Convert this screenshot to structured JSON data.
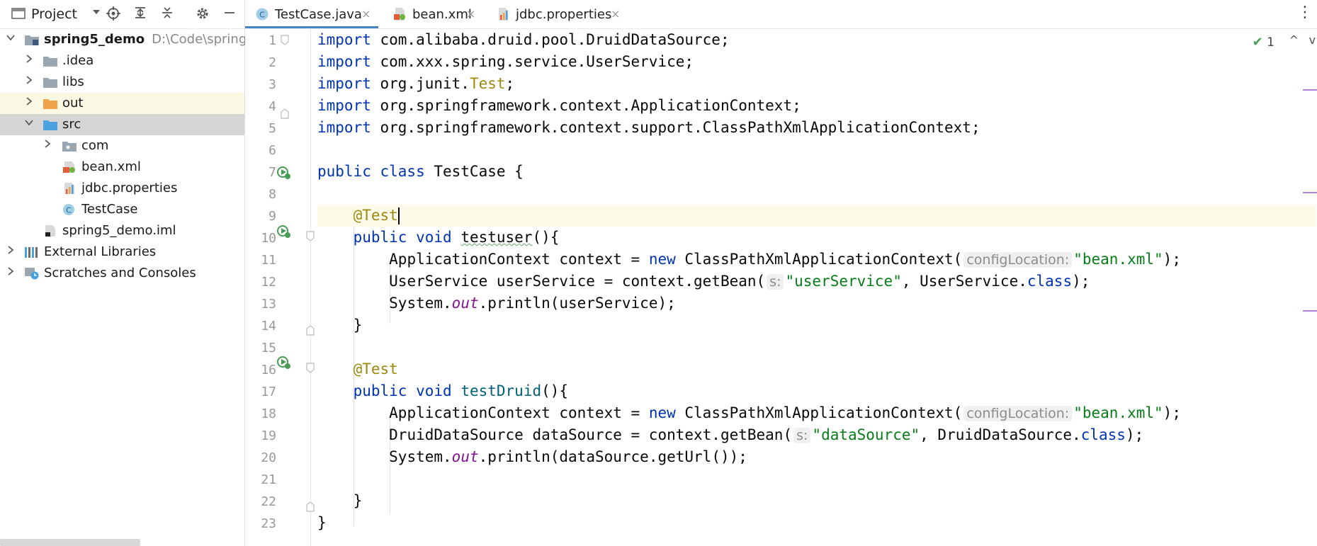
{
  "project": {
    "title": "Project",
    "icons": [
      "project-view-icon",
      "dropdown-chevron-icon",
      "locate-target-icon",
      "expand-all-icon",
      "collapse-all-icon",
      "gear-icon",
      "minimize-icon"
    ]
  },
  "tree": [
    {
      "label": "spring5_demo",
      "path": "D:\\Code\\spring\\s",
      "icon": "module-folder-icon",
      "expanded": true
    },
    {
      "label": ".idea",
      "icon": "folder-icon"
    },
    {
      "label": "libs",
      "icon": "folder-icon"
    },
    {
      "label": "out",
      "icon": "orange-folder-icon"
    },
    {
      "label": "src",
      "icon": "source-folder-icon",
      "expanded": true
    },
    {
      "label": "com",
      "icon": "package-icon"
    },
    {
      "label": "bean.xml",
      "icon": "xml-file-icon"
    },
    {
      "label": "jdbc.properties",
      "icon": "properties-file-icon"
    },
    {
      "label": "TestCase",
      "icon": "java-class-icon"
    },
    {
      "label": "spring5_demo.iml",
      "icon": "iml-file-icon"
    },
    {
      "label": "External Libraries",
      "icon": "libraries-icon"
    },
    {
      "label": "Scratches and Consoles",
      "icon": "scratches-icon"
    }
  ],
  "tabs": [
    {
      "label": "TestCase.java",
      "icon": "java-class-icon",
      "active": true
    },
    {
      "label": "bean.xml",
      "icon": "xml-file-icon",
      "active": false
    },
    {
      "label": "jdbc.properties",
      "icon": "properties-file-icon",
      "active": false
    }
  ],
  "tab_close": "×",
  "tab_more": "⋮",
  "inspection": {
    "count": "1",
    "up": "^",
    "down": "v"
  },
  "code": {
    "line_numbers": [
      "1",
      "2",
      "3",
      "4",
      "5",
      "6",
      "7",
      "8",
      "9",
      "10",
      "11",
      "12",
      "13",
      "14",
      "15",
      "16",
      "17",
      "18",
      "19",
      "20",
      "21",
      "22",
      "23"
    ],
    "l1": {
      "kw": "import",
      "text": " com.alibaba.druid.pool.DruidDataSource;"
    },
    "l2": {
      "kw": "import",
      "text": " com.xxx.spring.service.UserService;"
    },
    "l3": {
      "kw": "import",
      "pre": " org.junit.",
      "ann": "Test",
      "post": ";"
    },
    "l4": {
      "kw": "import",
      "text": " org.springframework.context.ApplicationContext;"
    },
    "l5": {
      "kw": "import",
      "text": " org.springframework.context.support.ClassPathXmlApplicationContext;"
    },
    "l7": {
      "kw": "public class",
      "text": " TestCase {"
    },
    "l9": {
      "ann": "@Test"
    },
    "l10": {
      "kw": "public void",
      "name": "testuser",
      "text": "(){"
    },
    "l11": {
      "pre": "ApplicationContext context = ",
      "kw": "new",
      "mid": " ClassPathXmlApplicationContext(",
      "hint": "configLocation:",
      "str": "\"bean.xml\"",
      "post": ");"
    },
    "l12": {
      "pre": "UserService userService = context.getBean(",
      "hint": "s:",
      "str": "\"userService\"",
      "mid": ", UserService.",
      "kw": "class",
      "post": ");"
    },
    "l13": {
      "pre": "System.",
      "it": "out",
      "post": ".println(userService);"
    },
    "l14": {
      "text": "}"
    },
    "l16": {
      "ann": "@Test"
    },
    "l17": {
      "kw": "public void",
      "name": "testDruid",
      "text": "(){"
    },
    "l18": {
      "pre": "ApplicationContext context = ",
      "kw": "new",
      "mid": " ClassPathXmlApplicationContext(",
      "hint": "configLocation:",
      "str": "\"bean.xml\"",
      "post": ");"
    },
    "l19": {
      "pre": "DruidDataSource dataSource = context.getBean(",
      "hint": "s:",
      "str": "\"dataSource\"",
      "mid": ", DruidDataSource.",
      "kw": "class",
      "post": ");"
    },
    "l20": {
      "pre": "System.",
      "it": "out",
      "post": ".println(dataSource.getUrl());"
    },
    "l22": {
      "text": "}"
    },
    "l23": {
      "text": "}"
    }
  },
  "colors": {
    "keyword": "#0033b3",
    "annotation": "#9e880d",
    "string": "#067d17",
    "static_field": "#871094",
    "tab_underline": "#4083c9",
    "selected_row": "#d5d5d5",
    "current_line": "#fcfae9"
  }
}
